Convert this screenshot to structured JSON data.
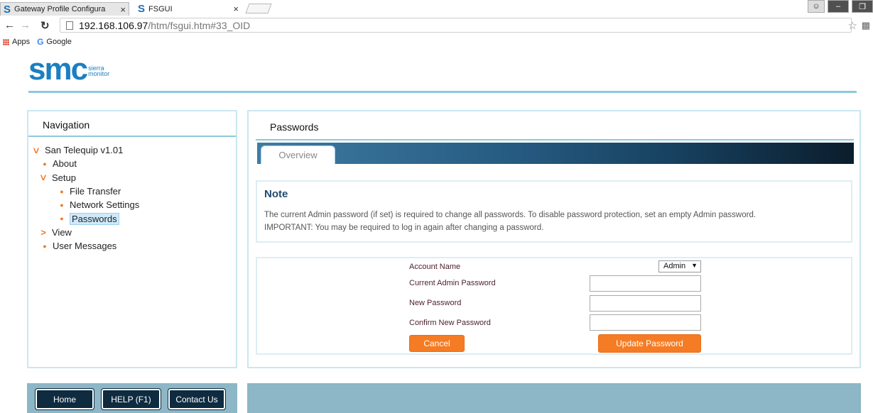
{
  "browser": {
    "tabs": [
      {
        "title": "Gateway Profile Configura",
        "logo": "S"
      },
      {
        "title": "FSGUI",
        "logo": "S"
      }
    ],
    "close_glyph": "×",
    "url_host": "192.168.106.97",
    "url_path": "/htm/fsgui.htm#33_OID",
    "bookmarks": {
      "apps": "Apps",
      "google": "Google",
      "google_letter": "G"
    }
  },
  "brand": {
    "mark": "smc",
    "sub_line1": "sierra",
    "sub_line2": "monitor"
  },
  "navigation": {
    "title": "Navigation",
    "items": [
      {
        "label": "San Telequip v1.01",
        "level": 0,
        "marker": "expanded"
      },
      {
        "label": "About",
        "level": 1,
        "marker": "bullet"
      },
      {
        "label": "Setup",
        "level": 1,
        "marker": "expanded"
      },
      {
        "label": "File Transfer",
        "level": 2,
        "marker": "bullet"
      },
      {
        "label": "Network Settings",
        "level": 2,
        "marker": "bullet"
      },
      {
        "label": "Passwords",
        "level": 2,
        "marker": "bullet",
        "selected": true
      },
      {
        "label": "View",
        "level": 1,
        "marker": "collapsed"
      },
      {
        "label": "User Messages",
        "level": 1,
        "marker": "bullet"
      }
    ]
  },
  "main": {
    "title": "Passwords",
    "tab": "Overview",
    "note": {
      "title": "Note",
      "line1": "The current Admin password (if set) is required to change all passwords. To disable password protection, set an empty Admin password.",
      "line2": "IMPORTANT: You may be required to log in again after changing a password."
    },
    "form": {
      "account_label": "Account Name",
      "account_value": "Admin",
      "current_label": "Current Admin Password",
      "current_value": "",
      "new_label": "New Password",
      "new_value": "",
      "confirm_label": "Confirm New Password",
      "confirm_value": "",
      "cancel": "Cancel",
      "update": "Update Password"
    }
  },
  "footer": {
    "home": "Home",
    "help": "HELP (F1)",
    "contact": "Contact Us"
  },
  "colors": {
    "accent": "#f57c24",
    "brand": "#1b7fc2",
    "rule": "#8cc9dc",
    "footer": "#8db6c7",
    "footer_button": "#0e2b40"
  }
}
